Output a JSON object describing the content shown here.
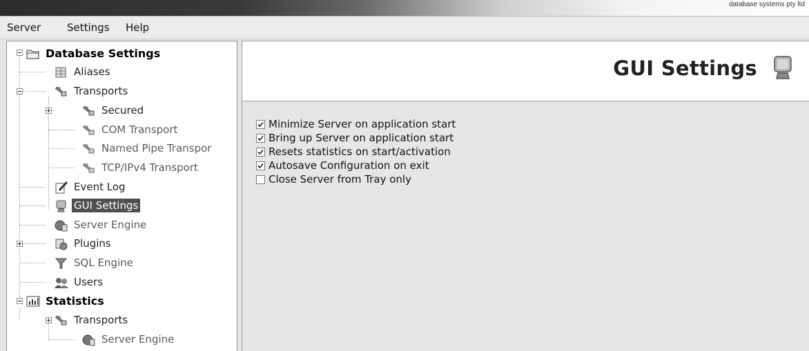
{
  "banner": {
    "tagline": "database systems pty ltd"
  },
  "menu": {
    "items": [
      "Server",
      "Settings",
      "Help"
    ]
  },
  "tree": {
    "nodes": [
      {
        "label": "Database Settings",
        "icon": "folder-icon",
        "style": "bold",
        "expander": "minus"
      },
      {
        "label": "Aliases",
        "icon": "aliases-icon",
        "style": "normal"
      },
      {
        "label": "Transports",
        "icon": "transport-icon",
        "style": "normal",
        "expander": "minus"
      },
      {
        "label": "Secured",
        "icon": "transport-icon",
        "style": "normal",
        "expander": "plus"
      },
      {
        "label": "COM Transport",
        "icon": "transport-icon",
        "style": "grey"
      },
      {
        "label": "Named Pipe Transpor",
        "icon": "transport-icon",
        "style": "grey"
      },
      {
        "label": "TCP/IPv4 Transport",
        "icon": "transport-icon",
        "style": "grey"
      },
      {
        "label": "Event Log",
        "icon": "event-log-icon",
        "style": "normal"
      },
      {
        "label": "GUI Settings",
        "icon": "monitor-icon",
        "style": "selected"
      },
      {
        "label": "Server Engine",
        "icon": "server-engine-icon",
        "style": "grey"
      },
      {
        "label": "Plugins",
        "icon": "plugins-icon",
        "style": "normal",
        "expander": "plus"
      },
      {
        "label": "SQL Engine",
        "icon": "sql-engine-icon",
        "style": "grey"
      },
      {
        "label": "Users",
        "icon": "users-icon",
        "style": "normal"
      },
      {
        "label": "Statistics",
        "icon": "statistics-icon",
        "style": "bold",
        "expander": "minus"
      },
      {
        "label": "Transports",
        "icon": "transport-icon",
        "style": "normal",
        "expander": "plus"
      },
      {
        "label": "Server Engine",
        "icon": "server-engine-icon",
        "style": "grey"
      }
    ]
  },
  "content": {
    "title": "GUI Settings",
    "title_icon": "monitor-icon",
    "options": [
      {
        "label": "Minimize Server on application start",
        "checked": true
      },
      {
        "label": "Bring up Server on application start",
        "checked": true
      },
      {
        "label": "Resets statistics on start/activation",
        "checked": true
      },
      {
        "label": "Autosave Configuration on exit",
        "checked": true
      },
      {
        "label": "Close Server from Tray only",
        "checked": false
      }
    ]
  }
}
